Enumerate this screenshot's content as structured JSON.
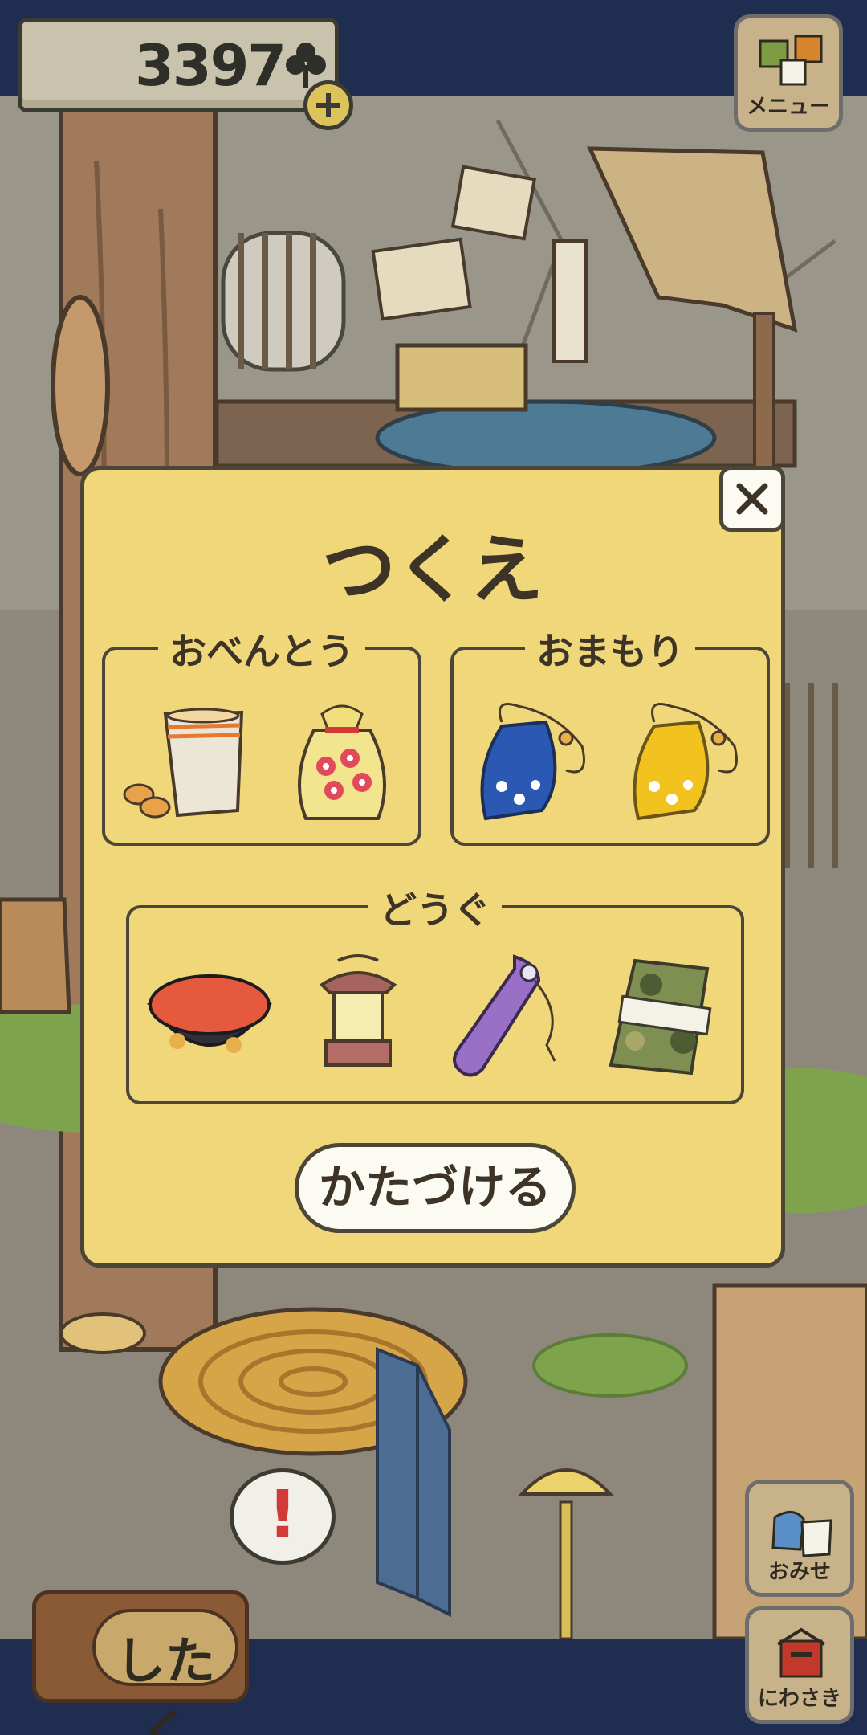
{
  "currency": {
    "value": "3397",
    "icon": "clover-icon",
    "add_icon": "plus-icon"
  },
  "top_right": {
    "menu_label": "メニュー"
  },
  "modal": {
    "title": "つくえ",
    "sections": [
      {
        "label": "おべんとう",
        "items": [
          "bread-bag-icon",
          "flower-wrap-bag-icon"
        ]
      },
      {
        "label": "おまもり",
        "items": [
          "blue-charm-pouch-icon",
          "yellow-charm-pouch-icon"
        ]
      },
      {
        "label": "どうぐ",
        "items": [
          "red-bowl-icon",
          "lantern-icon",
          "purple-bottle-icon",
          "camo-tenugui-icon"
        ]
      }
    ],
    "put_away_label": "かたづける",
    "close_icon": "close-icon"
  },
  "bottom_left": {
    "shitaku_label": "したく"
  },
  "bottom_right": {
    "omise_label": "おみせ",
    "niwasaki_label": "にわさき"
  },
  "notification": {
    "symbol": "!"
  },
  "colors": {
    "frame": "#1f2d50",
    "modal_bg": "#efd77a",
    "text": "#3d3427",
    "accent_red": "#d23a38"
  }
}
